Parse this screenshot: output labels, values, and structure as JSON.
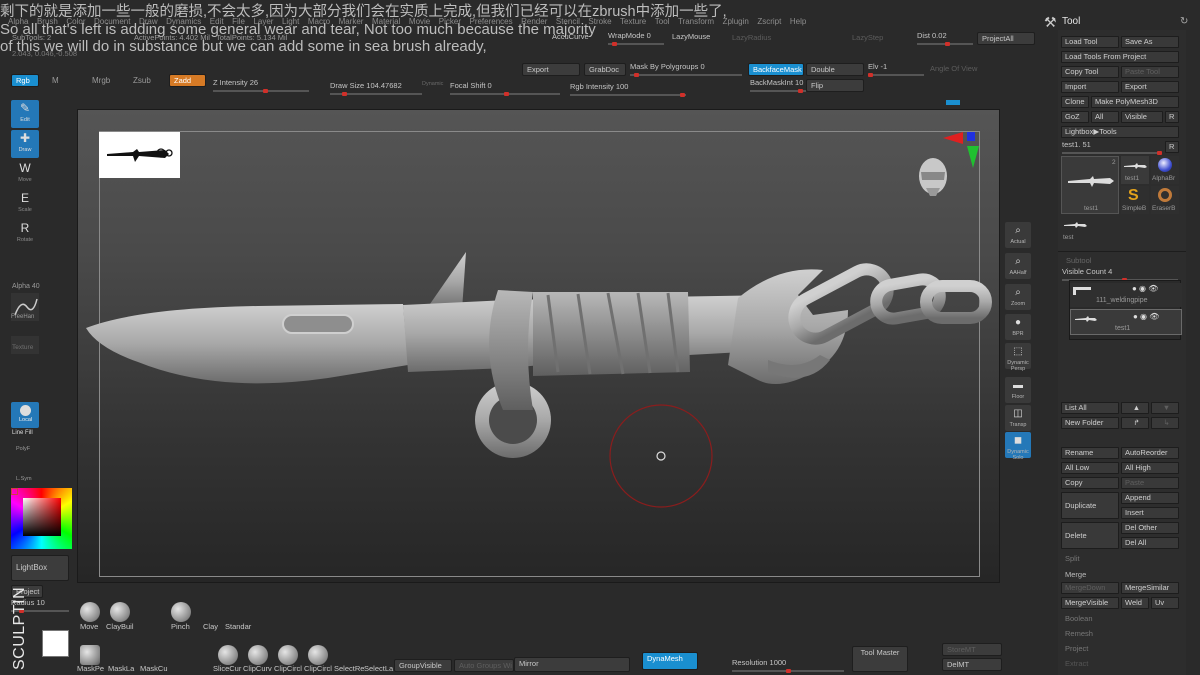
{
  "menu": [
    "Alpha",
    "Brush",
    "Color",
    "Document",
    "Draw",
    "Dynamics",
    "Edit",
    "File",
    "Layer",
    "Light",
    "Macro",
    "Marker",
    "Material",
    "Movie",
    "Picker",
    "Preferences",
    "Render",
    "Stencil",
    "Stroke",
    "Texture",
    "Tool",
    "Transform",
    "Zplugin",
    "Zscript",
    "Help"
  ],
  "stats": {
    "subtools": "SubTools: 2",
    "active_points": "ActivePoints: 4.402 Mil",
    "total_points": "TotalPoints: 5.134 Mil",
    "coords": "2.043, 0.046,-0.508"
  },
  "toprow1": {
    "accucurve": "AccuCurve",
    "wrapmode": "WrapMode",
    "wrapmode_val": "0",
    "lazymouse": "LazyMouse",
    "lazyradius": "LazyRadius",
    "lazystep": "LazyStep",
    "dist": "Dist",
    "dist_val": "0.02",
    "projectall": "ProjectAll"
  },
  "toprow2": {
    "export": "Export",
    "grabdoc": "GrabDoc",
    "mask_by_polygroups": "Mask By Polygroups",
    "mask_by_polygroups_val": "0",
    "backfacemask": "BackfaceMask",
    "double": "Double",
    "elv": "Elv",
    "elv_val": "-1",
    "angle_of_view": "Angle Of View",
    "backmaskint": "BackMaskInt",
    "backmaskint_val": "10",
    "flip": "Flip"
  },
  "brushbar": {
    "rgb": "Rgb",
    "m": "M",
    "mrgb": "Mrgb",
    "zsub": "Zsub",
    "zadd": "Zadd",
    "z_intensity": "Z Intensity",
    "z_intensity_val": "26",
    "draw_size": "Draw Size",
    "draw_size_val": "104.47682",
    "dynamic": "Dynamic",
    "focal_shift": "Focal Shift",
    "focal_shift_val": "0",
    "rgb_intensity": "Rgb Intensity",
    "rgb_intensity_val": "100"
  },
  "lefttools": [
    {
      "label": "Edit",
      "icon": "edit-icon",
      "glyph": "✎"
    },
    {
      "label": "Draw",
      "icon": "draw-icon",
      "glyph": "✚"
    },
    {
      "label": "Move",
      "icon": "move-icon",
      "glyph": "W"
    },
    {
      "label": "Scale",
      "icon": "scale-icon",
      "glyph": "E"
    },
    {
      "label": "Rotate",
      "icon": "rotate-icon",
      "glyph": "R"
    }
  ],
  "leftpanel": {
    "alpha": "Alpha 40",
    "freehand": "FreeHan",
    "texture": "Texture",
    "local": "Local",
    "linefill": "Line Fill",
    "polyf": "PolyF",
    "lsym": "L.Sym",
    "lightbox": "LightBox",
    "project": "Project",
    "radius": "Radius",
    "radius_val": "10",
    "color_primary": "#ffffff"
  },
  "viewport_shelf": [
    {
      "label": "Actual",
      "icon": "actual-icon"
    },
    {
      "label": "AAHalf",
      "icon": "aahalf-icon"
    },
    {
      "label": "Zoom",
      "icon": "zoom-icon"
    },
    {
      "label": "BPR",
      "icon": "bpr-icon"
    },
    {
      "label": "Dynamic Persp",
      "icon": "persp-icon"
    },
    {
      "label": "Floor",
      "icon": "floor-icon"
    },
    {
      "label": "Transp",
      "icon": "transp-icon"
    },
    {
      "label": "Dynamic Solo",
      "icon": "solo-icon"
    }
  ],
  "toolpanel": {
    "title": "Tool",
    "load_tool": "Load Tool",
    "save_as": "Save As",
    "load_tools_from_project": "Load Tools From Project",
    "copy_tool": "Copy Tool",
    "paste_tool": "Paste Tool",
    "import": "Import",
    "export": "Export",
    "clone": "Clone",
    "make_polymesh": "Make PolyMesh3D",
    "goz": "GoZ",
    "all": "All",
    "visible": "Visible",
    "r": "R",
    "lightbox_tools": "Lightbox▶Tools",
    "current_tool": "test1.",
    "current_tool_val": "51",
    "thumbs": [
      "test1",
      "test1",
      "AlphaBr",
      "SimpleB",
      "EraserB",
      "test"
    ],
    "thumb_count": "2",
    "subtool_header": "Subtool",
    "visible_count": "Visible Count",
    "visible_count_val": "4",
    "subtool_1": "111_weldingpipe",
    "subtool_2": "test1",
    "list_all": "List All",
    "new_folder": "New Folder",
    "rename": "Rename",
    "autoreorder": "AutoReorder",
    "all_low": "All Low",
    "all_high": "All High",
    "copy": "Copy",
    "paste": "Paste",
    "duplicate": "Duplicate",
    "append": "Append",
    "insert": "Insert",
    "delete": "Delete",
    "del_other": "Del Other",
    "del_all": "Del All",
    "split": "Split",
    "merge": "Merge",
    "merge_down": "MergeDown",
    "merge_similar": "MergeSimilar",
    "merge_visible": "MergeVisible",
    "weld": "Weld",
    "uv": "Uv",
    "boolean": "Boolean",
    "remesh": "Remesh",
    "project": "Project",
    "extract": "Extract"
  },
  "bottombar": {
    "brushes_row1": [
      "Move",
      "ClayBuil",
      "Pinch",
      "Clay",
      "Standar"
    ],
    "brushes_row2": [
      "MaskPe",
      "MaskLa",
      "MaskCu",
      "SliceCur",
      "ClipCurv",
      "ClipCircl",
      "ClipCircl",
      "SelectRe",
      "SelectLa"
    ],
    "groupvisible": "GroupVisible",
    "auto_groups": "Auto Groups Wi",
    "mirror": "Mirror",
    "dynamesh": "DynaMesh",
    "resolution": "Resolution",
    "resolution_val": "1000",
    "tool_master": "Tool Master",
    "storemt": "StoreMT",
    "delmt": "DelMT"
  },
  "subtitles": {
    "zh": "剩下的就是添加一些一般的磨损,不会太多,因为大部分我们会在实质上完成,但我们已经可以在zbrush中添加一些了,",
    "en1": "So all that's left is adding some general wear and tear, Not too much because the majority",
    "en2": "of this we will do in substance but we can add some in sea brush already,"
  },
  "watermark": "SCULPTING"
}
